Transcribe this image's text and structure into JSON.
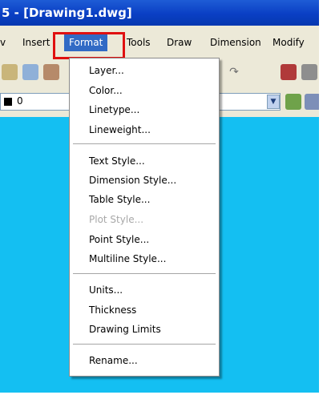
{
  "window": {
    "title": "5 - [Drawing1.dwg]"
  },
  "menubar": {
    "items": [
      {
        "label": "v"
      },
      {
        "label": "Insert"
      },
      {
        "label": "Format"
      },
      {
        "label": "Tools"
      },
      {
        "label": "Draw"
      },
      {
        "label": "Dimension"
      },
      {
        "label": "Modify"
      }
    ],
    "active": "Format",
    "highlight_color": "#e01010"
  },
  "layer_toolbar": {
    "current_layer": "0"
  },
  "format_menu": {
    "group1": [
      "Layer...",
      "Color...",
      "Linetype...",
      "Lineweight..."
    ],
    "group2": [
      "Text Style...",
      "Dimension Style...",
      "Table Style...",
      "Plot Style...",
      "Point Style...",
      "Multiline Style..."
    ],
    "group3": [
      "Units...",
      "Thickness",
      "Drawing Limits"
    ],
    "group4": [
      "Rename..."
    ],
    "disabled": [
      "Plot Style..."
    ]
  },
  "colors": {
    "title_bar": "#0a3fc4",
    "canvas": "#14bff2",
    "menu_background": "#ffffff",
    "selected_menu": "#316ac5"
  }
}
